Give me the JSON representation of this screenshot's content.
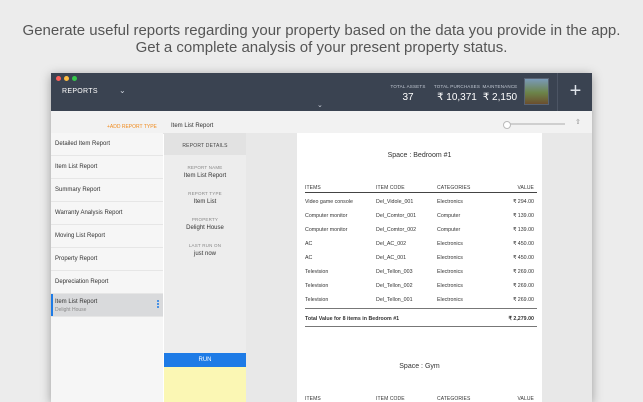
{
  "caption": {
    "line1": "Generate useful reports regarding your property based on the data you provide in the app.",
    "line2": "Get a complete analysis of your present property status."
  },
  "titlebar": {
    "section_label": "REPORTS",
    "stats": [
      {
        "label": "TOTAL ASSETS",
        "value": "37"
      },
      {
        "label": "TOTAL PURCHASES",
        "value": "₹ 10,371"
      },
      {
        "label": "MAINTENANCE",
        "value": "₹ 2,150"
      }
    ],
    "add_button": "+"
  },
  "toolbar": {
    "add_report_label": "+ADD REPORT TYPE",
    "current_report": "Item List Report"
  },
  "sidebar": {
    "items": [
      {
        "label": "Detailed Item Report"
      },
      {
        "label": "Item List Report"
      },
      {
        "label": "Summary Report"
      },
      {
        "label": "Warranty Analysis Report"
      },
      {
        "label": "Moving List Report"
      },
      {
        "label": "Property Report"
      },
      {
        "label": "Depreciation Report"
      }
    ],
    "active": {
      "label": "Item List Report",
      "subtitle": "Delight House"
    }
  },
  "details": {
    "title": "REPORT DETAILS",
    "fields": [
      {
        "label": "REPORT NAME",
        "value": "Item List Report"
      },
      {
        "label": "REPORT TYPE",
        "value": "Item List"
      },
      {
        "label": "PROPERTY",
        "value": "Delight House"
      },
      {
        "label": "LAST RUN ON",
        "value": "just now"
      }
    ],
    "run_label": "RUN"
  },
  "preview": {
    "space1": {
      "title": "Space : Bedroom #1",
      "headers": [
        "ITEMS",
        "ITEM CODE",
        "CATEGORIES",
        "VALUE"
      ],
      "rows": [
        [
          "Video game console",
          "Del_Vidole_001",
          "Electronics",
          "₹ 294.00"
        ],
        [
          "Computer monitor",
          "Del_Comtor_001",
          "Computer",
          "₹ 139.00"
        ],
        [
          "Computer monitor",
          "Del_Comtor_002",
          "Computer",
          "₹ 139.00"
        ],
        [
          "AC",
          "Del_AC_002",
          "Electronics",
          "₹ 450.00"
        ],
        [
          "AC",
          "Del_AC_001",
          "Electronics",
          "₹ 450.00"
        ],
        [
          "Television",
          "Del_Tellon_003",
          "Electronics",
          "₹ 269.00"
        ],
        [
          "Television",
          "Del_Tellon_002",
          "Electronics",
          "₹ 269.00"
        ],
        [
          "Television",
          "Del_Tellon_001",
          "Electronics",
          "₹ 269.00"
        ]
      ],
      "total_label": "Total Value for 8 items in Bedroom #1",
      "total_value": "₹ 2,279.00"
    },
    "space2": {
      "title": "Space : Gym",
      "headers": [
        "ITEMS",
        "ITEM CODE",
        "CATEGORIES",
        "VALUE"
      ]
    }
  }
}
